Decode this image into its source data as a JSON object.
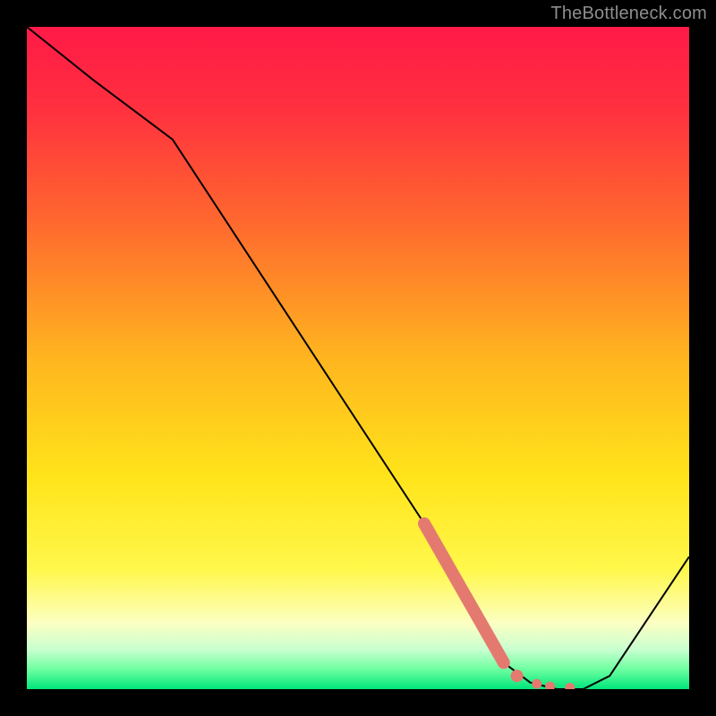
{
  "watermark": "TheBottleneck.com",
  "chart_data": {
    "type": "line",
    "title": "",
    "xlabel": "",
    "ylabel": "",
    "xlim": [
      0,
      100
    ],
    "ylim": [
      0,
      100
    ],
    "series": [
      {
        "name": "curve",
        "x": [
          0,
          10,
          22,
          60,
          72,
          76,
          80,
          84,
          88,
          100
        ],
        "y": [
          100,
          92,
          83,
          25,
          4,
          1,
          0,
          0,
          2,
          20
        ]
      }
    ],
    "highlight_segment": {
      "name": "thick-coral-segment",
      "x": [
        60,
        72
      ],
      "y": [
        25,
        4
      ]
    },
    "dotted_segment": {
      "name": "coral-dots",
      "points": [
        {
          "x": 74,
          "y": 2.0
        },
        {
          "x": 77,
          "y": 0.8
        },
        {
          "x": 79,
          "y": 0.4
        },
        {
          "x": 82,
          "y": 0.2
        }
      ]
    },
    "gradient_stops": [
      {
        "offset": 0.0,
        "color": "#ff1a47"
      },
      {
        "offset": 0.12,
        "color": "#ff2f3f"
      },
      {
        "offset": 0.3,
        "color": "#ff6a2e"
      },
      {
        "offset": 0.5,
        "color": "#ffb51f"
      },
      {
        "offset": 0.68,
        "color": "#ffe41a"
      },
      {
        "offset": 0.82,
        "color": "#fff84c"
      },
      {
        "offset": 0.9,
        "color": "#fcffc2"
      },
      {
        "offset": 0.94,
        "color": "#c9ffd0"
      },
      {
        "offset": 0.97,
        "color": "#6effa0"
      },
      {
        "offset": 1.0,
        "color": "#00e57a"
      }
    ],
    "colors": {
      "curve": "#000000",
      "highlight": "#e47a6f",
      "background_frame": "#000000"
    }
  }
}
